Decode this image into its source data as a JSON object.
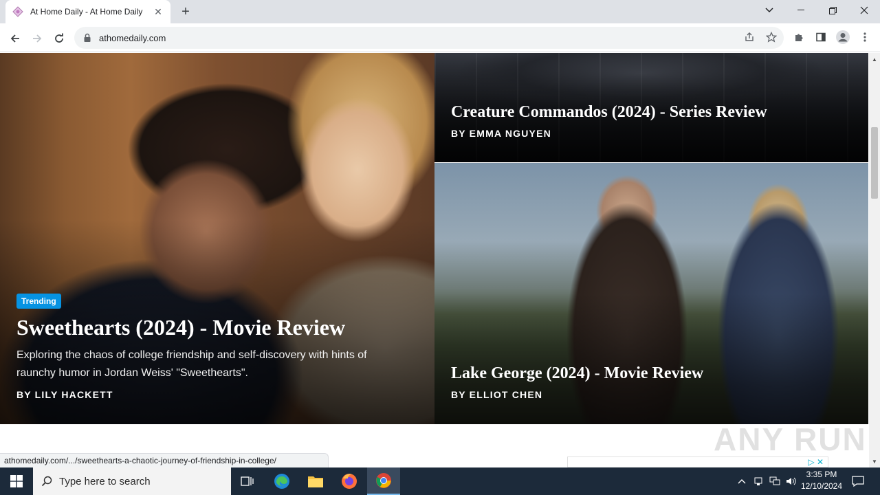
{
  "browser": {
    "tab_title": "At Home Daily - At Home Daily",
    "url": "athomedaily.com",
    "status_url": "athomedaily.com/.../sweethearts-a-chaotic-journey-of-friendship-in-college/"
  },
  "hero": {
    "badge": "Trending",
    "title": "Sweethearts (2024) - Movie Review",
    "excerpt": "Exploring the chaos of college friendship and self-discovery with hints of raunchy humor in Jordan Weiss' \"Sweethearts\".",
    "byline": "BY LILY HACKETT"
  },
  "cards": [
    {
      "title": "Creature Commandos (2024) - Series Review",
      "byline": "BY EMMA NGUYEN"
    },
    {
      "title": "Lake George (2024) - Movie Review",
      "byline": "BY ELLIOT CHEN"
    }
  ],
  "watermark": "ANY RUN",
  "taskbar": {
    "search_placeholder": "Type here to search",
    "time": "3:35 PM",
    "date": "12/10/2024"
  },
  "colors": {
    "accent_badge": "#0693e3",
    "taskbar_bg": "#1c2a3a",
    "tabbar_bg": "#dee1e6"
  }
}
